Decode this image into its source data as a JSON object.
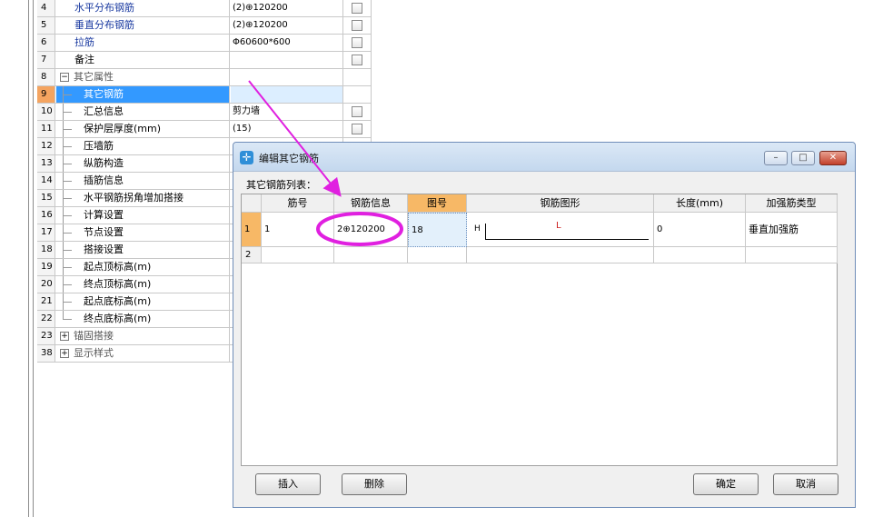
{
  "property_grid": {
    "rows": [
      {
        "num": "4",
        "name": "水平分布钢筋",
        "value": "(2)⊕120200",
        "checkbox": true,
        "style": "blue"
      },
      {
        "num": "5",
        "name": "垂直分布钢筋",
        "value": "(2)⊕120200",
        "checkbox": true,
        "style": "blue"
      },
      {
        "num": "6",
        "name": "拉筋",
        "value": "Φ60600*600",
        "checkbox": true,
        "style": "blue"
      },
      {
        "num": "7",
        "name": "备注",
        "value": "",
        "checkbox": true,
        "style": "plain"
      },
      {
        "num": "8",
        "name": "其它属性",
        "value": "",
        "checkbox": false,
        "style": "group-collapse"
      },
      {
        "num": "9",
        "name": "其它钢筋",
        "value": "",
        "checkbox": false,
        "style": "child-selected"
      },
      {
        "num": "10",
        "name": "汇总信息",
        "value": "剪力墙",
        "checkbox": true,
        "style": "child"
      },
      {
        "num": "11",
        "name": "保护层厚度(mm)",
        "value": "(15)",
        "checkbox": true,
        "style": "child"
      },
      {
        "num": "12",
        "name": "压墙筋",
        "value": "",
        "checkbox": false,
        "style": "child"
      },
      {
        "num": "13",
        "name": "纵筋构造",
        "value": "",
        "checkbox": false,
        "style": "child"
      },
      {
        "num": "14",
        "name": "插筋信息",
        "value": "",
        "checkbox": false,
        "style": "child"
      },
      {
        "num": "15",
        "name": "水平钢筋拐角增加搭接",
        "value": "",
        "checkbox": false,
        "style": "child"
      },
      {
        "num": "16",
        "name": "计算设置",
        "value": "",
        "checkbox": false,
        "style": "child"
      },
      {
        "num": "17",
        "name": "节点设置",
        "value": "",
        "checkbox": false,
        "style": "child"
      },
      {
        "num": "18",
        "name": "搭接设置",
        "value": "",
        "checkbox": false,
        "style": "child"
      },
      {
        "num": "19",
        "name": "起点顶标高(m)",
        "value": "",
        "checkbox": false,
        "style": "child"
      },
      {
        "num": "20",
        "name": "终点顶标高(m)",
        "value": "",
        "checkbox": false,
        "style": "child"
      },
      {
        "num": "21",
        "name": "起点底标高(m)",
        "value": "",
        "checkbox": false,
        "style": "child"
      },
      {
        "num": "22",
        "name": "终点底标高(m)",
        "value": "",
        "checkbox": false,
        "style": "child-last"
      },
      {
        "num": "23",
        "name": "锚固搭接",
        "value": "",
        "checkbox": false,
        "style": "group-expand"
      },
      {
        "num": "38",
        "name": "显示样式",
        "value": "",
        "checkbox": false,
        "style": "group-expand"
      }
    ]
  },
  "dialog": {
    "title": "编辑其它钢筋",
    "list_label": "其它钢筋列表：",
    "window_buttons": {
      "minimize": "–",
      "maximize": "□",
      "close": "✕"
    },
    "columns": [
      "筋号",
      "钢筋信息",
      "图号",
      "钢筋图形",
      "长度(mm)",
      "加强筋类型"
    ],
    "rows": [
      {
        "row_num": "1",
        "bar_no": "1",
        "rebar_info": "2⊕120200",
        "figure_no": "18",
        "shape_h": "H",
        "shape_l": "L",
        "length": "0",
        "type": "垂直加强筋"
      },
      {
        "row_num": "2",
        "bar_no": "",
        "rebar_info": "",
        "figure_no": "",
        "shape_h": "",
        "shape_l": "",
        "length": "",
        "type": ""
      }
    ],
    "buttons": {
      "insert": "插入",
      "delete": "删除",
      "ok": "确定",
      "cancel": "取消"
    }
  },
  "colors": {
    "annotation": "#e020e0",
    "selection_blue": "#3399ff",
    "row_header_active": "#f7b866"
  }
}
